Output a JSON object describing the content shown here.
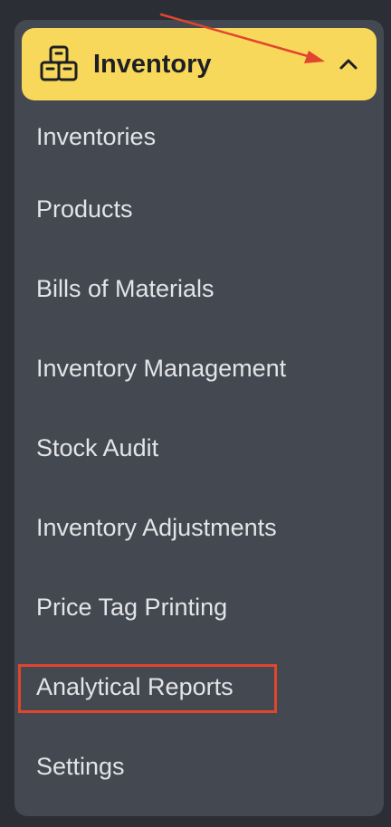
{
  "menu": {
    "title": "Inventory",
    "header_icon": "boxes-icon",
    "toggle_icon": "chevron-up-icon",
    "items": [
      {
        "label": "Inventories"
      },
      {
        "label": "Products"
      },
      {
        "label": "Bills of Materials"
      },
      {
        "label": "Inventory Management"
      },
      {
        "label": "Stock Audit"
      },
      {
        "label": "Inventory Adjustments"
      },
      {
        "label": "Price Tag Printing"
      },
      {
        "label": "Analytical Reports",
        "highlighted": true
      },
      {
        "label": "Settings"
      }
    ]
  },
  "colors": {
    "background": "#2b2f35",
    "panel": "#444851",
    "header_accent": "#f8d85a",
    "highlight_annotation": "#e2452f",
    "text": "#e3e4e8"
  }
}
